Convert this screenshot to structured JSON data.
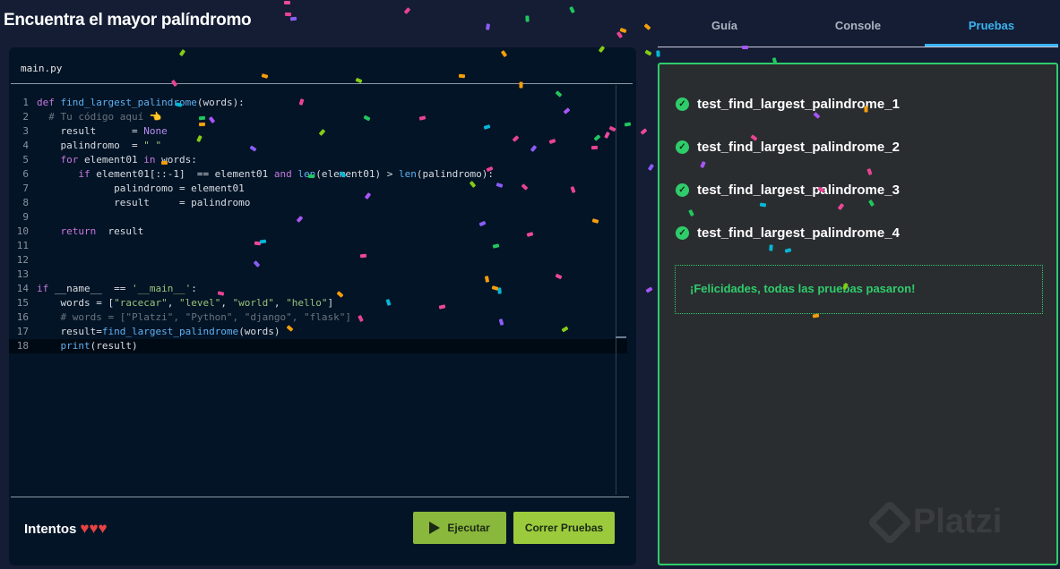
{
  "title": "Encuentra el mayor palíndromo",
  "editor": {
    "filename": "main.py",
    "lines": [
      {
        "n": "1",
        "html": "<span class='kw'>def</span> <span class='fn'>find_largest_palindrome</span>(words):"
      },
      {
        "n": "2",
        "html": "  <span class='cm'># Tu código aquí</span> 👈"
      },
      {
        "n": "3",
        "html": "    result      = <span class='nn'>None</span>"
      },
      {
        "n": "4",
        "html": "    palindromo  = <span class='str'>\" \"</span>"
      },
      {
        "n": "5",
        "html": "    <span class='kw'>for</span> element01 <span class='kw'>in</span> words:"
      },
      {
        "n": "6",
        "html": "       <span class='kw'>if</span> element01[::-1]  == element01 <span class='kw'>and</span> <span class='fn'>len</span>(element01) > <span class='fn'>len</span>(palindromo):"
      },
      {
        "n": "7",
        "html": "             palindromo = element01"
      },
      {
        "n": "8",
        "html": "             result     = palindromo"
      },
      {
        "n": "9",
        "html": ""
      },
      {
        "n": "10",
        "html": "    <span class='kw'>return</span>  result"
      },
      {
        "n": "11",
        "html": ""
      },
      {
        "n": "12",
        "html": ""
      },
      {
        "n": "13",
        "html": ""
      },
      {
        "n": "14",
        "html": "<span class='kw'>if</span> __name__  == <span class='str'>'__main__'</span>:"
      },
      {
        "n": "15",
        "html": "    words = [<span class='str'>\"racecar\"</span>, <span class='str'>\"level\"</span>, <span class='str'>\"world\"</span>, <span class='str'>\"hello\"</span>]"
      },
      {
        "n": "16",
        "html": "    <span class='cm'># words = [\"Platzi\", \"Python\", \"django\", \"flask\"]</span>"
      },
      {
        "n": "17",
        "html": "    result=<span class='fn'>find_largest_palindrome</span>(words)"
      },
      {
        "n": "18",
        "html": "    <span class='fn'>print</span>(result)"
      }
    ]
  },
  "footer": {
    "attempts_label": "Intentos",
    "hearts": 3,
    "run_label": "Ejecutar",
    "test_label": "Correr Pruebas"
  },
  "tabs": [
    {
      "label": "Guía"
    },
    {
      "label": "Console"
    },
    {
      "label": "Pruebas"
    }
  ],
  "tests": [
    {
      "name": "test_find_largest_palindrome_1"
    },
    {
      "name": "test_find_largest_palindrome_2"
    },
    {
      "name": "test_find_largest_palindrome_3"
    },
    {
      "name": "test_find_largest_palindrome_4"
    }
  ],
  "success_message": "¡Felicidades, todas las pruebas pasaron!",
  "watermark": "Platzi",
  "colors": {
    "accent": "#3ab3f2",
    "success": "#2fcc6b",
    "button": "#9bcb3c"
  }
}
